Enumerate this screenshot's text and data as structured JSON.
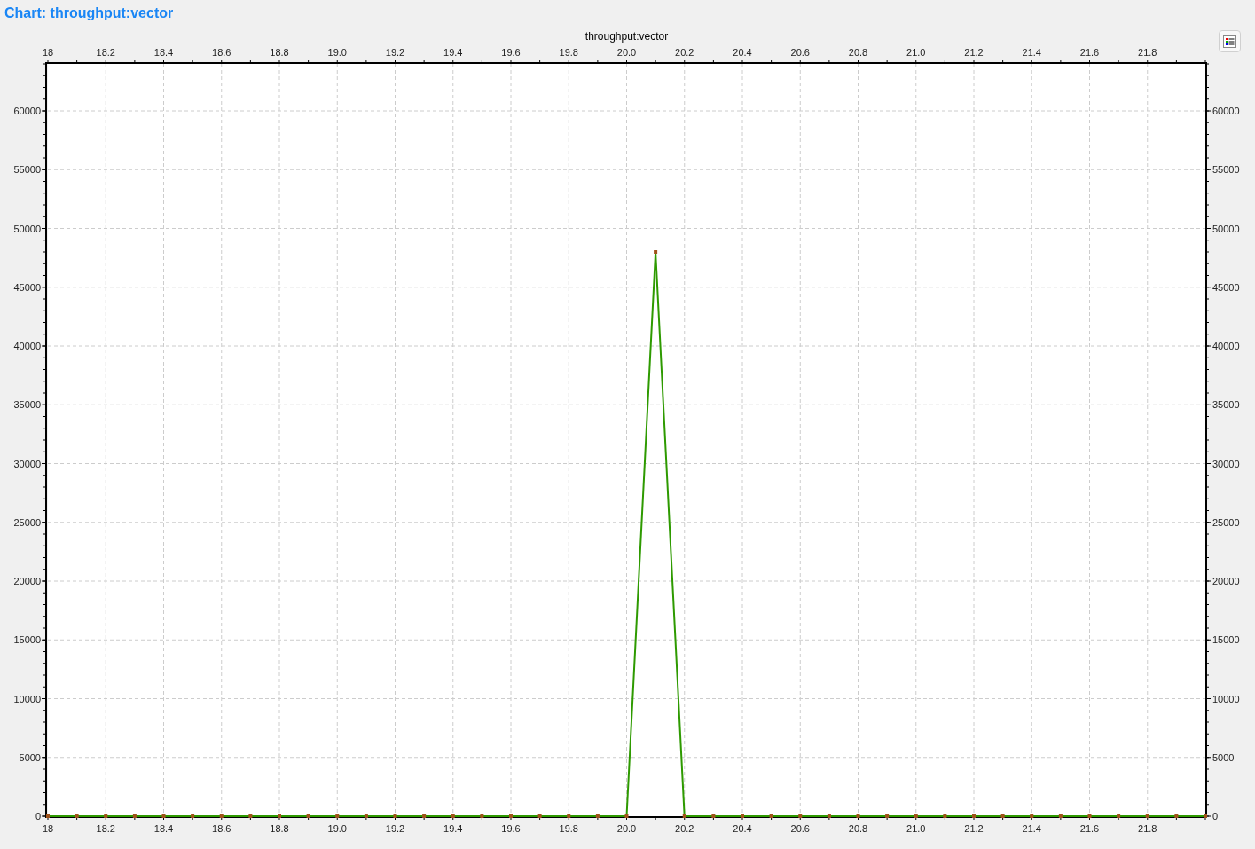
{
  "header": {
    "title": "Chart: throughput:vector"
  },
  "chart": {
    "chart_data": {
      "type": "line",
      "title": "throughput:vector",
      "x": [
        18.0,
        18.1,
        18.2,
        18.3,
        18.4,
        18.5,
        18.6,
        18.7,
        18.8,
        18.9,
        19.0,
        19.1,
        19.2,
        19.3,
        19.4,
        19.5,
        19.6,
        19.7,
        19.8,
        19.9,
        20.0,
        20.1,
        20.2,
        20.3,
        20.4,
        20.5,
        20.6,
        20.7,
        20.8,
        20.9,
        21.0,
        21.1,
        21.2,
        21.3,
        21.4,
        21.5,
        21.6,
        21.7,
        21.8,
        21.9,
        22.0
      ],
      "grid": true,
      "series": [
        {
          "color": "#2e9a00",
          "marker": "square",
          "values": [
            0,
            0,
            0,
            0,
            0,
            0,
            0,
            0,
            0,
            0,
            0,
            0,
            0,
            0,
            0,
            0,
            0,
            0,
            0,
            0,
            0,
            48000,
            0,
            0,
            0,
            0,
            0,
            0,
            0,
            0,
            0,
            0,
            0,
            0,
            0,
            0,
            0,
            0,
            0,
            0,
            0
          ]
        }
      ],
      "xlim": [
        18,
        22
      ],
      "ylim": [
        0,
        64000
      ],
      "xticks": [
        {
          "value": 18,
          "label": "18"
        },
        {
          "value": 18.2,
          "label": "18.2"
        },
        {
          "value": 18.4,
          "label": "18.4"
        },
        {
          "value": 18.6,
          "label": "18.6"
        },
        {
          "value": 18.8,
          "label": "18.8"
        },
        {
          "value": 19,
          "label": "19.0"
        },
        {
          "value": 19.2,
          "label": "19.2"
        },
        {
          "value": 19.4,
          "label": "19.4"
        },
        {
          "value": 19.6,
          "label": "19.6"
        },
        {
          "value": 19.8,
          "label": "19.8"
        },
        {
          "value": 20,
          "label": "20.0"
        },
        {
          "value": 20.2,
          "label": "20.2"
        },
        {
          "value": 20.4,
          "label": "20.4"
        },
        {
          "value": 20.6,
          "label": "20.6"
        },
        {
          "value": 20.8,
          "label": "20.8"
        },
        {
          "value": 21,
          "label": "21.0"
        },
        {
          "value": 21.2,
          "label": "21.2"
        },
        {
          "value": 21.4,
          "label": "21.4"
        },
        {
          "value": 21.6,
          "label": "21.6"
        },
        {
          "value": 21.8,
          "label": "21.8"
        }
      ],
      "yticks": [
        0,
        5000,
        10000,
        15000,
        20000,
        25000,
        30000,
        35000,
        40000,
        45000,
        50000,
        55000,
        60000
      ]
    },
    "top_axis_labels": [
      "18",
      "18.2",
      "18.4",
      "18.6",
      "18.8",
      "19.0",
      "19.2",
      "19.4",
      "19.6",
      "19.8",
      "20.0",
      "20.2",
      "20.4",
      "20.6",
      "20.8",
      "21.0",
      "21.2",
      "21.4",
      "21.6",
      "21.8"
    ],
    "left_axis_labels": [
      "60000",
      "55000",
      "50000",
      "45000",
      "40000",
      "35000",
      "30000",
      "25000",
      "20000",
      "15000",
      "10000",
      "5000",
      "0"
    ],
    "right_axis_labels": [
      "60000",
      "55000",
      "50000",
      "45000",
      "40000",
      "35000",
      "30000",
      "25000",
      "20000",
      "15000",
      "10000",
      "5000",
      "0"
    ]
  }
}
